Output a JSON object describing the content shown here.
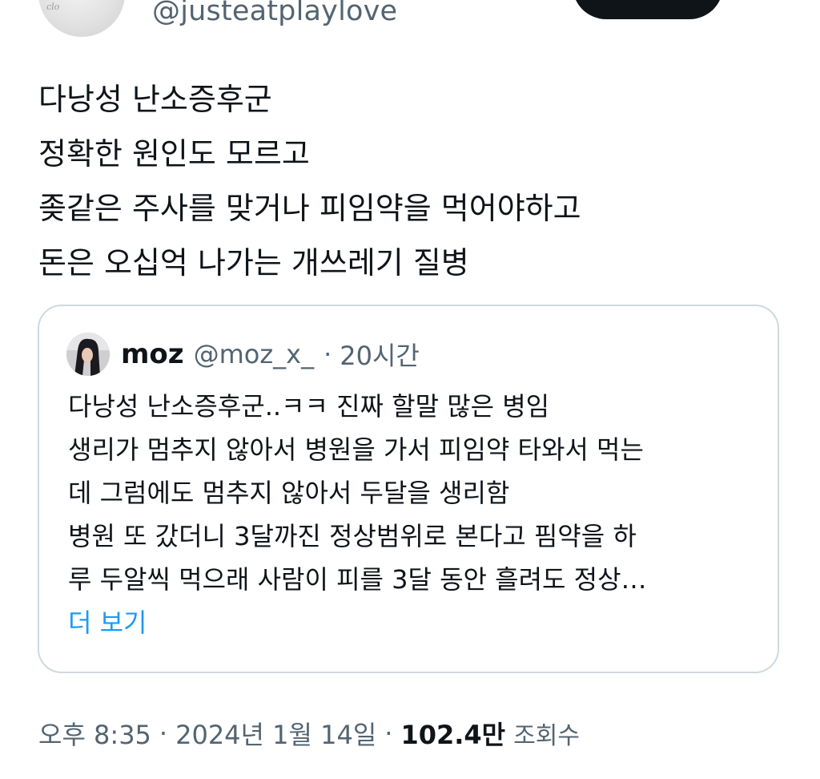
{
  "author": {
    "handle": "@justeatplaylove",
    "avatar_mark": "clo"
  },
  "tweet": {
    "lines": [
      "다낭성 난소증후군",
      "정확한 원인도 모르고",
      "좆같은 주사를 맞거나 피임약을 먹어야하고",
      "돈은 오십억 나가는 개쓰레기 질병"
    ]
  },
  "quote": {
    "name": "moz",
    "handle": "@moz_x_",
    "separator": "·",
    "time": "20시간",
    "lines": [
      "다낭성 난소증후군..ㅋㅋ 진짜 할말 많은 병임",
      "생리가 멈추지 않아서 병원을 가서 피임약 타와서 먹는",
      "데 그럼에도 멈추지 않아서 두달을 생리함",
      "병원 또 갔더니 3달까진 정상범위로 본다고 핌약을 하",
      "루 두알씩 먹으래 사람이 피를 3달 동안 흘려도 정상…"
    ],
    "show_more": "더 보기"
  },
  "meta": {
    "time": "오후 8:35",
    "separator": "·",
    "date": "2024년 1월 14일",
    "views": "102.4만",
    "views_label": "조회수"
  },
  "colors": {
    "text": "#0f1419",
    "secondary": "#536471",
    "link": "#1d9bf0",
    "border": "#cfd9de",
    "button": "#0f1419"
  }
}
